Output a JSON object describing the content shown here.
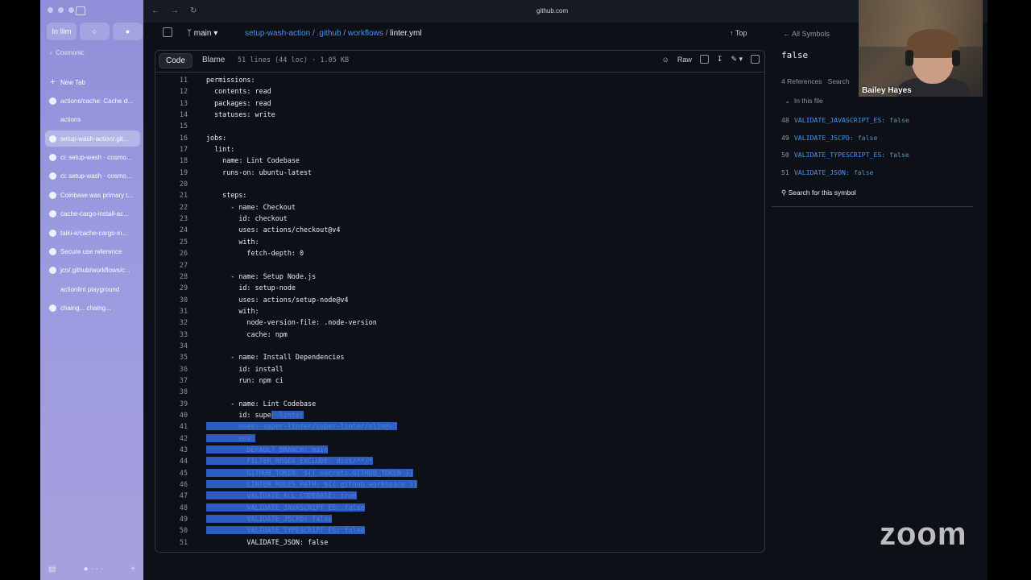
{
  "browser": {
    "url": "github.com",
    "pins": [
      "In Ilim",
      "",
      ""
    ],
    "space": "Cosmonic",
    "tabs": [
      {
        "label": "New Tab",
        "icon": "plus",
        "active": false
      },
      {
        "label": "actions/cache: Cache d...",
        "icon": "github",
        "active": false
      },
      {
        "label": "actions",
        "icon": "none",
        "active": false
      },
      {
        "label": "setup-wash-action/.git...",
        "icon": "github",
        "active": true
      },
      {
        "label": "ci: setup-wash · cosmo...",
        "icon": "github",
        "active": false
      },
      {
        "label": "ci: setup-wash · cosmo...",
        "icon": "github",
        "active": false
      },
      {
        "label": "Coinbase was primary t...",
        "icon": "square",
        "active": false
      },
      {
        "label": "cache-cargo-install-ac...",
        "icon": "github",
        "active": false
      },
      {
        "label": "taiki-e/cache-cargo-in...",
        "icon": "github",
        "active": false
      },
      {
        "label": "Secure use reference",
        "icon": "dot",
        "active": false
      },
      {
        "label": "jco/.github/workflows/c...",
        "icon": "github",
        "active": false
      },
      {
        "label": "actionlint playground",
        "icon": "none",
        "active": false
      },
      {
        "label": "chaing...   chaing...",
        "icon": "github",
        "active": false
      }
    ]
  },
  "repo": {
    "branch": "main",
    "crumbs": [
      "setup-wash-action",
      ".github",
      "workflows"
    ],
    "file": "linter.yml",
    "top_label": "Top"
  },
  "toolbar": {
    "code_label": "Code",
    "blame_label": "Blame",
    "file_info": "51 lines (44 loc) · 1.05 KB",
    "raw_label": "Raw"
  },
  "code_lines": [
    {
      "n": "11",
      "t": "permissions:",
      "sel": ""
    },
    {
      "n": "12",
      "t": "  contents: read",
      "sel": ""
    },
    {
      "n": "13",
      "t": "  packages: read",
      "sel": ""
    },
    {
      "n": "14",
      "t": "  statuses: write",
      "sel": ""
    },
    {
      "n": "15",
      "t": "",
      "sel": ""
    },
    {
      "n": "16",
      "t": "jobs:",
      "sel": ""
    },
    {
      "n": "17",
      "t": "  lint:",
      "sel": ""
    },
    {
      "n": "18",
      "t": "    name: Lint Codebase",
      "sel": ""
    },
    {
      "n": "19",
      "t": "    runs-on: ubuntu-latest",
      "sel": ""
    },
    {
      "n": "20",
      "t": "",
      "sel": ""
    },
    {
      "n": "21",
      "t": "    steps:",
      "sel": ""
    },
    {
      "n": "22",
      "t": "      - name: Checkout",
      "sel": ""
    },
    {
      "n": "23",
      "t": "        id: checkout",
      "sel": ""
    },
    {
      "n": "24",
      "t": "        uses: actions/checkout@v4",
      "sel": ""
    },
    {
      "n": "25",
      "t": "        with:",
      "sel": ""
    },
    {
      "n": "26",
      "t": "          fetch-depth: 0",
      "sel": ""
    },
    {
      "n": "27",
      "t": "",
      "sel": ""
    },
    {
      "n": "28",
      "t": "      - name: Setup Node.js",
      "sel": ""
    },
    {
      "n": "29",
      "t": "        id: setup-node",
      "sel": ""
    },
    {
      "n": "30",
      "t": "        uses: actions/setup-node@v4",
      "sel": ""
    },
    {
      "n": "31",
      "t": "        with:",
      "sel": ""
    },
    {
      "n": "32",
      "t": "          node-version-file: .node-version",
      "sel": ""
    },
    {
      "n": "33",
      "t": "          cache: npm",
      "sel": ""
    },
    {
      "n": "34",
      "t": "",
      "sel": ""
    },
    {
      "n": "35",
      "t": "      - name: Install Dependencies",
      "sel": ""
    },
    {
      "n": "36",
      "t": "        id: install",
      "sel": ""
    },
    {
      "n": "37",
      "t": "        run: npm ci",
      "sel": ""
    },
    {
      "n": "38",
      "t": "",
      "sel": ""
    },
    {
      "n": "39",
      "t": "      - name: Lint Codebase",
      "sel": ""
    },
    {
      "n": "40",
      "t": "        id: supe",
      "sel": "r-linter"
    },
    {
      "n": "41",
      "t": "",
      "sel": "        uses: super-linter/super-linter/slim@v7"
    },
    {
      "n": "42",
      "t": "",
      "sel": "        env:"
    },
    {
      "n": "43",
      "t": "",
      "sel": "          DEFAULT_BRANCH: main"
    },
    {
      "n": "44",
      "t": "",
      "sel": "          FILTER_REGEX_EXCLUDE: dist/**/*"
    },
    {
      "n": "45",
      "t": "",
      "sel": "          GITHUB_TOKEN: ${{ secrets.GITHUB_TOKEN }}"
    },
    {
      "n": "46",
      "t": "",
      "sel": "          LINTER_RULES_PATH: ${{ github.workspace }}"
    },
    {
      "n": "47",
      "t": "",
      "sel": "          VALIDATE_ALL_CODEBASE: true"
    },
    {
      "n": "48",
      "t": "",
      "sel": "          VALIDATE_JAVASCRIPT_ES: false"
    },
    {
      "n": "49",
      "t": "",
      "sel": "          VALIDATE_JSCPD: false"
    },
    {
      "n": "50",
      "t": "",
      "sel": "          VALIDATE_TYPESCRIPT_ES: false"
    },
    {
      "n": "51",
      "t": "          VALIDATE_JSON: false",
      "sel": ""
    }
  ],
  "symbols": {
    "back_label": "All Symbols",
    "query": "false",
    "refs_label": "4 References",
    "search_label": "Search",
    "in_file_label": "In this file",
    "items": [
      {
        "n": "48",
        "key": "VALIDATE_JAVASCRIPT_ES:",
        "val": "false"
      },
      {
        "n": "49",
        "key": "VALIDATE_JSCPD:",
        "val": "false"
      },
      {
        "n": "50",
        "key": "VALIDATE_TYPESCRIPT_ES:",
        "val": "false"
      },
      {
        "n": "51",
        "key": "VALIDATE_JSON:",
        "val": "false"
      }
    ],
    "search_symbol_label": "Search for this symbol"
  },
  "webcam": {
    "name": "Bailey Hayes"
  },
  "zoom_logo": "zoom"
}
